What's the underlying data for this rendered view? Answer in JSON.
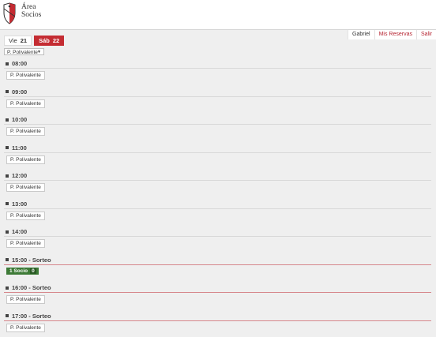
{
  "header": {
    "brand_line1": "Área",
    "brand_line2": "Socios"
  },
  "userbar": {
    "user": "Gabriel",
    "reservations": "Mis Reservas",
    "logout": "Salir"
  },
  "days": [
    {
      "name": "Vie",
      "num": "21",
      "active": false
    },
    {
      "name": "Sáb",
      "num": "22",
      "active": true
    }
  ],
  "court_select": {
    "selected": "P. Polivalente"
  },
  "slots": [
    {
      "time": "08:00",
      "court": "P. Polivalente"
    },
    {
      "time": "09:00",
      "court": "P. Polivalente"
    },
    {
      "time": "10:00",
      "court": "P. Polivalente"
    },
    {
      "time": "11:00",
      "court": "P. Polivalente"
    },
    {
      "time": "12:00",
      "court": "P. Polivalente"
    },
    {
      "time": "13:00",
      "court": "P. Polivalente"
    },
    {
      "time": "14:00",
      "court": "P. Polivalente"
    },
    {
      "time": "15:00 - Sorteo",
      "badge": "1 Socio",
      "badge_count": "0"
    },
    {
      "time": "16:00 - Sorteo",
      "court": "P. Polivalente"
    },
    {
      "time": "17:00 - Sorteo",
      "court": "P. Polivalente"
    }
  ],
  "colors": {
    "accent": "#c42c32",
    "badge": "#3d7a36"
  }
}
